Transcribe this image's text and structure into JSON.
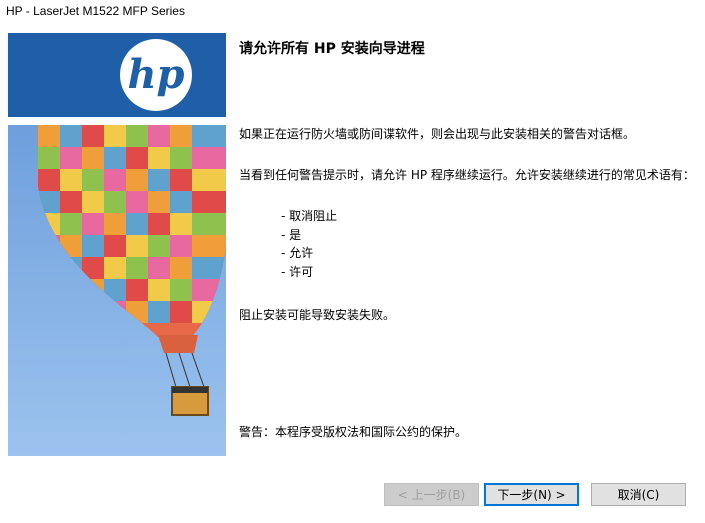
{
  "window": {
    "title": "HP - LaserJet M1522 MFP Series"
  },
  "brand": {
    "logo_text": "hp",
    "logo_color": "#1f5fa8"
  },
  "main": {
    "heading": "请允许所有 HP 安装向导进程",
    "para1": "如果正在运行防火墙或防间谍软件，则会出现与此安装相关的警告对话框。",
    "para2": "当看到任何警告提示时，请允许 HP 程序继续运行。允许安装继续进行的常见术语有：",
    "options": [
      "- 取消阻止",
      "- 是",
      "- 允许",
      "- 许可"
    ],
    "para3": "阻止安装可能导致安装失败。",
    "warning": "警告：本程序受版权法和国际公约的保护。"
  },
  "buttons": {
    "back": "< 上一步(B)",
    "next": "下一步(N) >",
    "cancel": "取消(C)"
  }
}
